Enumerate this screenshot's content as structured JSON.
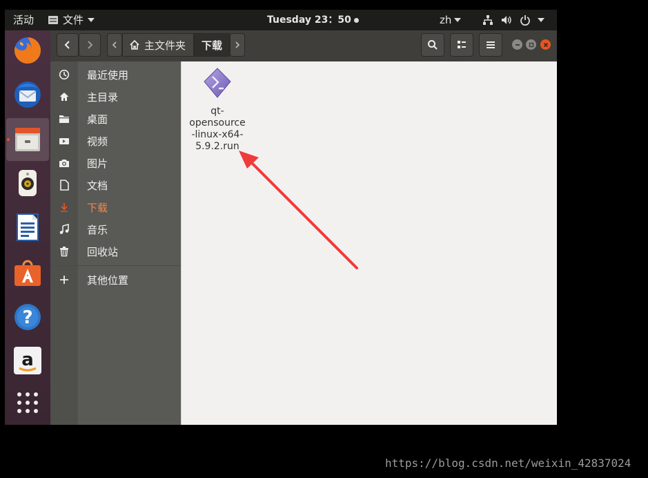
{
  "topbar": {
    "activities": "活动",
    "app_menu": "文件",
    "clock": "Tuesday 23：50",
    "lang": "zh"
  },
  "dock": {
    "apps": [
      "firefox-icon",
      "thunderbird-icon",
      "files-icon",
      "rhythmbox-icon",
      "writer-icon",
      "software-icon",
      "help-icon",
      "amazon-icon",
      "apps-grid-icon"
    ]
  },
  "header": {
    "home_label": "主文件夹",
    "current_label": "下载"
  },
  "sidebar": {
    "items": [
      {
        "label": "最近使用",
        "icon": "clock-icon"
      },
      {
        "label": "主目录",
        "icon": "home-icon"
      },
      {
        "label": "桌面",
        "icon": "folder-icon"
      },
      {
        "label": "视频",
        "icon": "video-icon"
      },
      {
        "label": "图片",
        "icon": "camera-icon"
      },
      {
        "label": "文档",
        "icon": "document-icon"
      },
      {
        "label": "下载",
        "icon": "download-icon"
      },
      {
        "label": "音乐",
        "icon": "music-icon"
      },
      {
        "label": "回收站",
        "icon": "trash-icon"
      }
    ],
    "other": "其他位置"
  },
  "files": [
    {
      "name": "qt-opensource-linux-x64-5.9.2.run",
      "lines": [
        "qt-",
        "opensource",
        "-linux-x64-",
        "5.9.2.run"
      ]
    }
  ],
  "colors": {
    "accent": "#e95420",
    "arrow": "#f03b3b"
  },
  "watermark": "https://blog.csdn.net/weixin_42837024"
}
